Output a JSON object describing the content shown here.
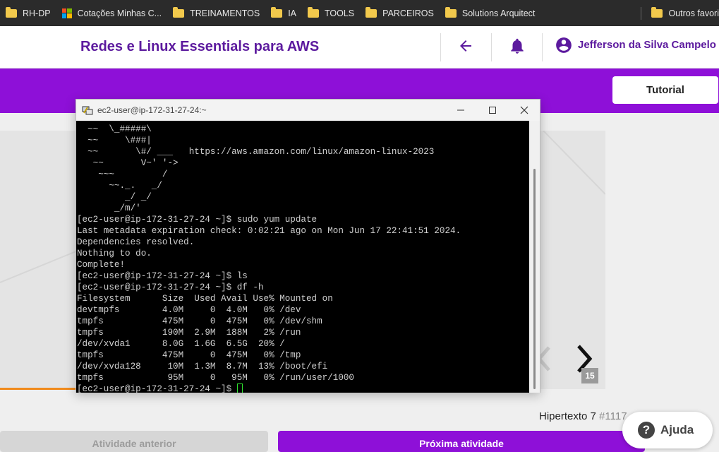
{
  "bookmarks": {
    "items": [
      {
        "label": "RH-DP",
        "icon": "folder-icon"
      },
      {
        "label": "Cotações Minhas C...",
        "icon": "microsoft-icon"
      },
      {
        "label": "TREINAMENTOS",
        "icon": "folder-icon"
      },
      {
        "label": "IA",
        "icon": "folder-icon"
      },
      {
        "label": "TOOLS",
        "icon": "folder-icon"
      },
      {
        "label": "PARCEIROS",
        "icon": "folder-icon"
      },
      {
        "label": "Solutions Arquitect",
        "icon": "folder-icon"
      }
    ],
    "other": "Outros favori"
  },
  "header": {
    "course_title": "Redes e Linux Essentials para AWS",
    "user_name": "Jefferson da Silva Campelo",
    "icons": [
      "back-arrow-icon",
      "bell-icon",
      "account-circle-icon"
    ]
  },
  "band": {
    "tutorial_label": "Tutorial"
  },
  "colors": {
    "brand_purple": "#8e10d8",
    "title_purple": "#5c1a9e",
    "progress_orange": "#f08a1c"
  },
  "content": {
    "page_badge": "15",
    "hypertext_label": "Hipertexto 7",
    "hypertext_num": "#1117"
  },
  "footer": {
    "prev_label": "Atividade anterior",
    "next_label": "Próxima atividade",
    "help_label": "Ajuda"
  },
  "terminal": {
    "title": "ec2-user@ip-172-31-27-24:~",
    "lines": [
      "  ~~  \\_#####\\",
      "  ~~     \\###|",
      "  ~~       \\#/ ___   https://aws.amazon.com/linux/amazon-linux-2023",
      "   ~~       V~' '->",
      "    ~~~         /",
      "      ~~._.   _/",
      "         _/ _/",
      "       _/m/'",
      "[ec2-user@ip-172-31-27-24 ~]$ sudo yum update",
      "Last metadata expiration check: 0:02:21 ago on Mon Jun 17 22:41:51 2024.",
      "Dependencies resolved.",
      "Nothing to do.",
      "Complete!",
      "[ec2-user@ip-172-31-27-24 ~]$ ls",
      "[ec2-user@ip-172-31-27-24 ~]$ df -h",
      "Filesystem      Size  Used Avail Use% Mounted on",
      "devtmpfs        4.0M     0  4.0M   0% /dev",
      "tmpfs           475M     0  475M   0% /dev/shm",
      "tmpfs           190M  2.9M  188M   2% /run",
      "/dev/xvda1      8.0G  1.6G  6.5G  20% /",
      "tmpfs           475M     0  475M   0% /tmp",
      "/dev/xvda128     10M  1.3M  8.7M  13% /boot/efi",
      "tmpfs            95M     0   95M   0% /run/user/1000"
    ],
    "prompt": "[ec2-user@ip-172-31-27-24 ~]$ "
  }
}
